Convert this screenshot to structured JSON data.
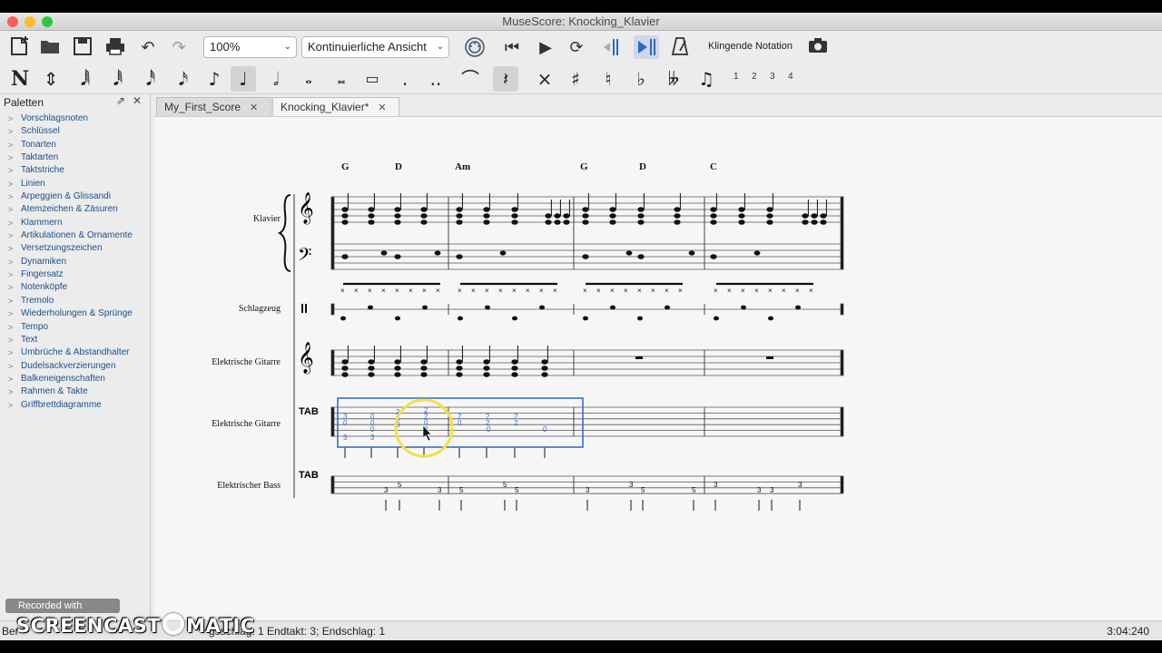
{
  "window": {
    "title": "MuseScore: Knocking_Klavier"
  },
  "toolbar": {
    "zoom": "100%",
    "view_mode": "Kontinuierliche Ansicht",
    "concert_pitch": "Klingende Notation",
    "voices": [
      "1",
      "2",
      "3",
      "4"
    ]
  },
  "note_input": {
    "mode_label": "N",
    "accidentals": [
      "×",
      "♯",
      "♮",
      "♭",
      "𝄫"
    ]
  },
  "palette": {
    "title": "Paletten",
    "items": [
      "Vorschlagsnoten",
      "Schlüssel",
      "Tonarten",
      "Taktarten",
      "Taktstriche",
      "Linien",
      "Arpeggien & Glissandi",
      "Atemzeichen & Zäsuren",
      "Klammern",
      "Artikulationen & Ornamente",
      "Versetzungszeichen",
      "Dynamiken",
      "Fingersatz",
      "Notenköpfe",
      "Tremolo",
      "Wiederholungen & Sprünge",
      "Tempo",
      "Text",
      "Umbrüche & Abstandhalter",
      "Dudelsackverzierungen",
      "Balkeneigenschaften",
      "Rahmen & Takte",
      "Griffbrettdiagramme"
    ]
  },
  "tabs": [
    {
      "label": "My_First_Score",
      "close": "✕"
    },
    {
      "label": "Knocking_Klavier*",
      "close": "✕"
    }
  ],
  "score": {
    "chords": [
      "G",
      "D",
      "Am",
      "G",
      "D",
      "C"
    ],
    "instruments": [
      "Klavier",
      "Schlagzeug",
      "Elektrische Gitarre",
      "Elektrische Gitarre",
      "Elektrischer Bass"
    ],
    "tab_label": "TAB",
    "tab_notes": [
      "3",
      "0",
      "0",
      "0",
      "3",
      "2",
      "3",
      "2",
      "0",
      "2",
      "2",
      "0",
      "2",
      "2",
      "0",
      "2",
      "2",
      "0",
      "0",
      "0",
      "3",
      "3"
    ],
    "bass_frets": [
      "3",
      "5",
      "3",
      "5",
      "5",
      "5",
      "3",
      "3",
      "5",
      "5",
      "3",
      "3",
      "3",
      "3"
    ]
  },
  "status": {
    "left": "Ber",
    "selection": "gsschlag: 1 Endtakt: 3; Endschlag: 1",
    "time": "3:04:240"
  },
  "overlay": {
    "recorded": "Recorded with",
    "brand": "SCREENCAST",
    "brand_suffix": "MATIC"
  },
  "colors": {
    "selection": "#3a6fc4",
    "cursor_highlight": "#f4e04a",
    "tab_digits": "#3a6fc4"
  }
}
